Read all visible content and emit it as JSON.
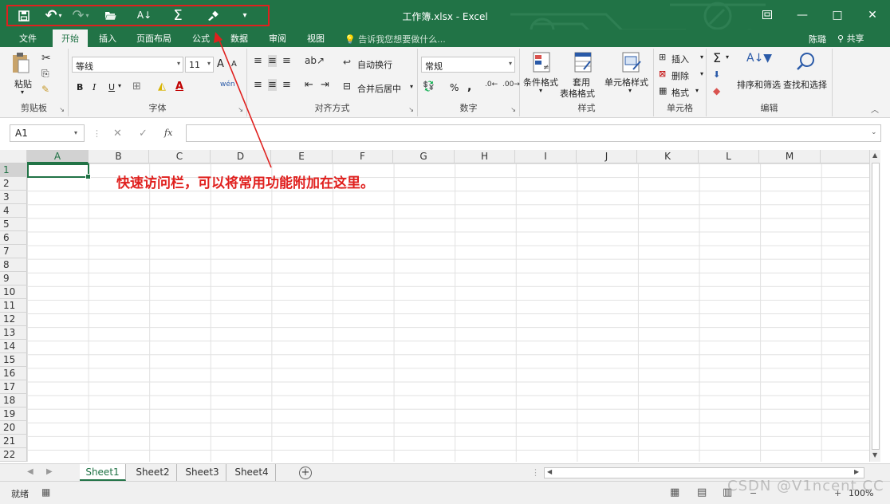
{
  "window": {
    "title": "工作簿.xlsx - Excel",
    "controls": {
      "options_icon": "ribbon-options-icon",
      "minimize": "—",
      "maximize": "□",
      "close": "✕"
    }
  },
  "qat": {
    "save": "🖫",
    "undo": "↶",
    "redo": "↷",
    "open": "📂",
    "sort": "A↓Z",
    "sum": "Σ",
    "format_painter": "🖌",
    "customize": "▾"
  },
  "tabs": [
    "文件",
    "开始",
    "插入",
    "页面布局",
    "公式",
    "数据",
    "审阅",
    "视图"
  ],
  "tell_me": "告诉我您想要做什么...",
  "user": "陈璐",
  "share": "共享",
  "ribbon": {
    "clipboard": {
      "label": "剪贴板",
      "paste": "粘贴"
    },
    "font": {
      "label": "字体",
      "name": "等线",
      "size": "11",
      "bold": "B",
      "italic": "I",
      "underline": "U",
      "grow": "A",
      "shrink": "A",
      "phonetic": "wén"
    },
    "alignment": {
      "label": "对齐方式",
      "wrap": "自动换行",
      "merge": "合并后居中"
    },
    "number": {
      "label": "数字",
      "format": "常规",
      "percent": "%",
      "comma": ","
    },
    "styles": {
      "label": "样式",
      "conditional": "条件格式",
      "table_a": "套用",
      "table_b": "表格格式",
      "cell_styles": "单元格样式"
    },
    "cells": {
      "label": "单元格",
      "insert": "插入",
      "delete": "删除",
      "format": "格式"
    },
    "editing": {
      "label": "编辑",
      "sort_filter": "排序和筛选",
      "find_select": "查找和选择",
      "sum": "Σ"
    }
  },
  "formula_bar": {
    "name_box": "A1",
    "cancel": "✕",
    "confirm": "✓",
    "fx": "fx",
    "value": ""
  },
  "columns": [
    "A",
    "B",
    "C",
    "D",
    "E",
    "F",
    "G",
    "H",
    "I",
    "J",
    "K",
    "L",
    "M"
  ],
  "rows": [
    "1",
    "2",
    "3",
    "4",
    "5",
    "6",
    "7",
    "8",
    "9",
    "10",
    "11",
    "12",
    "13",
    "14",
    "15",
    "16",
    "17",
    "18",
    "19",
    "20",
    "21",
    "22"
  ],
  "annotation": "快速访问栏，可以将常用功能附加在这里。",
  "sheets": [
    "Sheet1",
    "Sheet2",
    "Sheet3",
    "Sheet4"
  ],
  "add_sheet": "+",
  "status": {
    "ready": "就绪",
    "zoom": "100%"
  },
  "watermark": "CSDN @V1ncent CC",
  "colors": {
    "accent": "#217346",
    "annotation": "#e0201e"
  }
}
